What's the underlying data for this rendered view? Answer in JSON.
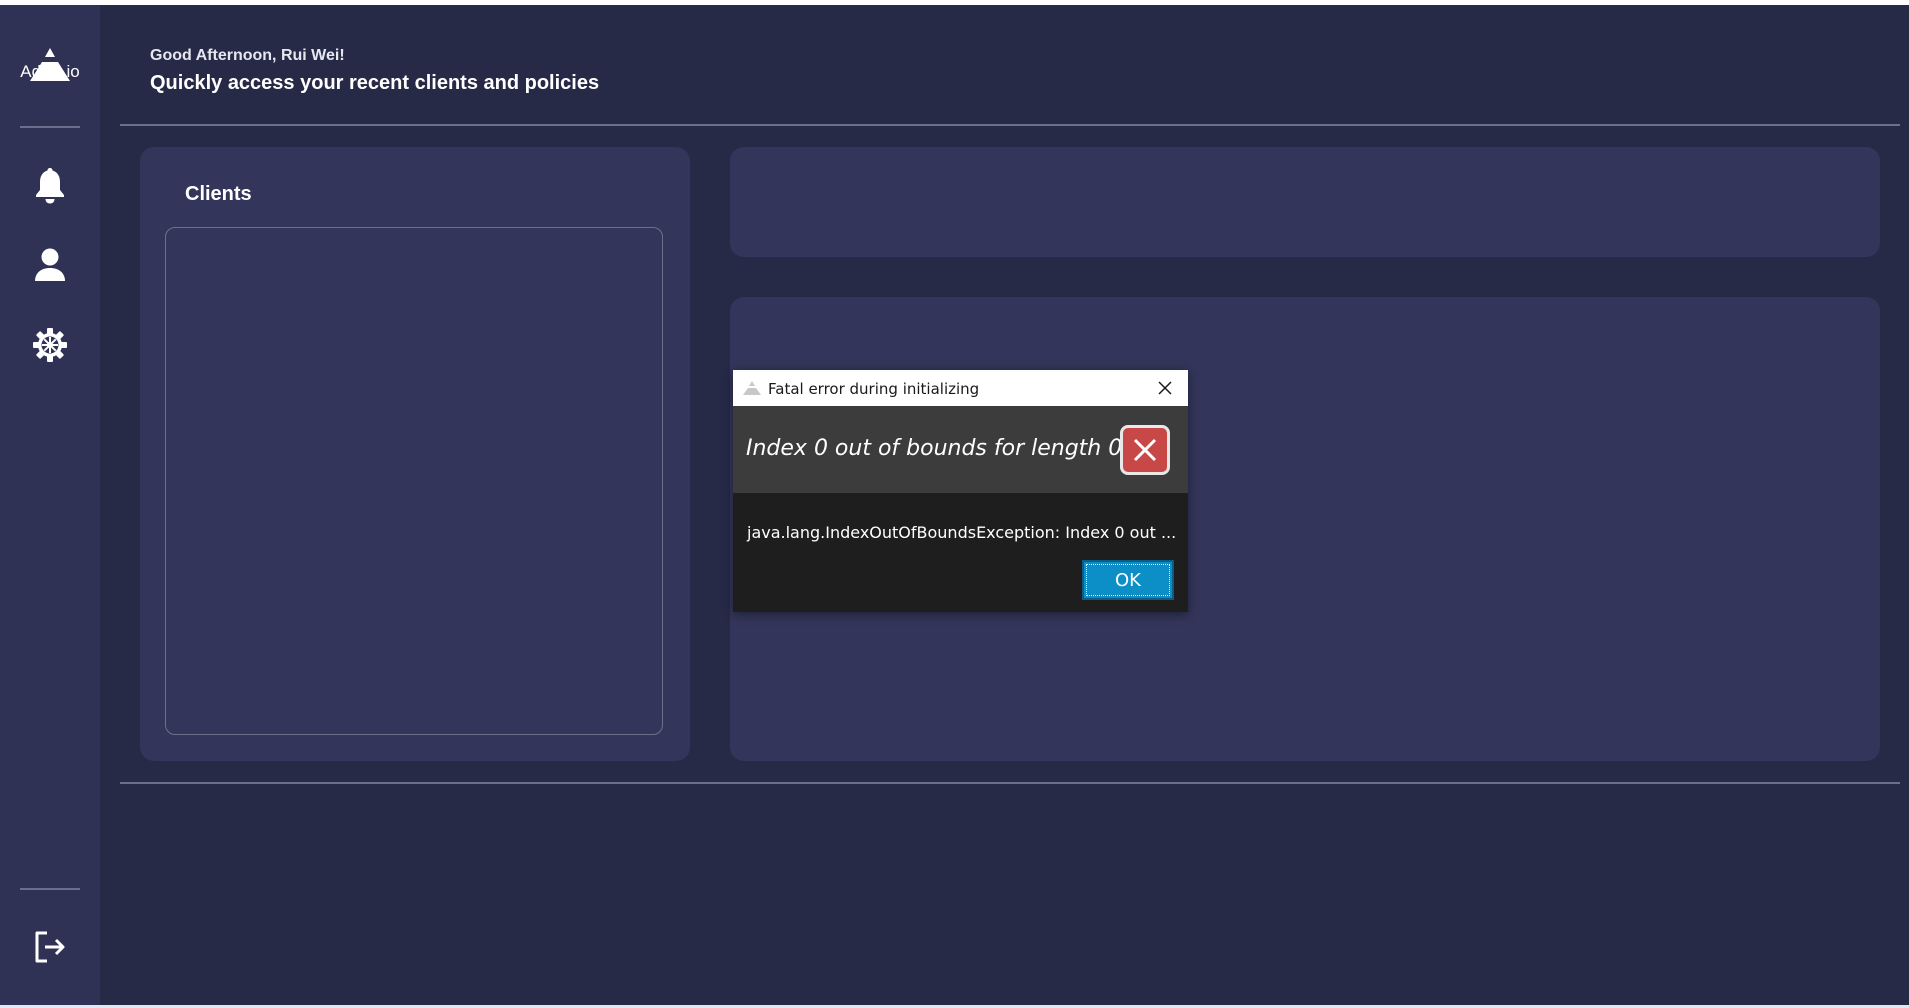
{
  "sidebar": {
    "logo_text": "Advis.io",
    "items": [
      {
        "name": "notifications",
        "icon": "bell-icon"
      },
      {
        "name": "profile",
        "icon": "user-icon"
      },
      {
        "name": "settings",
        "icon": "gear-icon"
      }
    ],
    "logout_icon": "logout-icon"
  },
  "header": {
    "greeting": "Good Afternoon, Rui Wei!",
    "subtitle": "Quickly access your recent clients and policies"
  },
  "clients_panel": {
    "title": "Clients"
  },
  "dialog": {
    "title": "Fatal error during initializing",
    "heading": "Index 0 out of bounds for length 0",
    "message": "java.lang.IndexOutOfBoundsException: Index 0 out ...",
    "ok_label": "OK"
  },
  "colors": {
    "background": "#272a47",
    "sidebar": "#2f3255",
    "panel": "#33365a",
    "divider": "#6c6f8c",
    "error_red": "#c84848",
    "ok_blue": "#0c8ec7"
  }
}
